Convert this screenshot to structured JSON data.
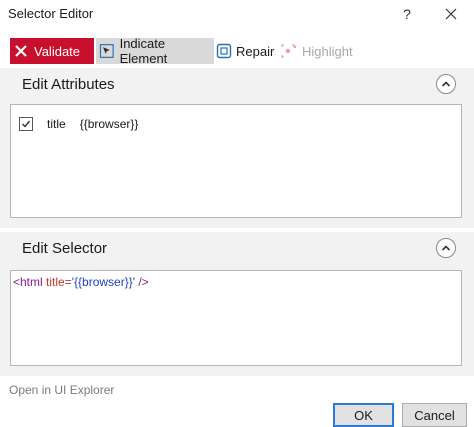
{
  "window": {
    "title": "Selector Editor",
    "help_glyph": "?"
  },
  "toolbar": {
    "validate_label": "Validate",
    "indicate_label": "Indicate Element",
    "repair_label": "Repair",
    "highlight_label": "Highlight"
  },
  "attributes": {
    "title": "Edit Attributes",
    "rows": [
      {
        "name": "title",
        "value": "{{browser}}",
        "checked": true
      }
    ]
  },
  "selector": {
    "title": "Edit Selector",
    "tag_open": "<html",
    "attr_name": "title=",
    "attr_value": "'{{browser}}'",
    "tag_close": " />"
  },
  "footer": {
    "open_in_explorer": "Open in UI Explorer",
    "ok_label": "OK",
    "cancel_label": "Cancel"
  },
  "colors": {
    "accent_red": "#c8102e",
    "focus_blue": "#2a7bd4"
  }
}
